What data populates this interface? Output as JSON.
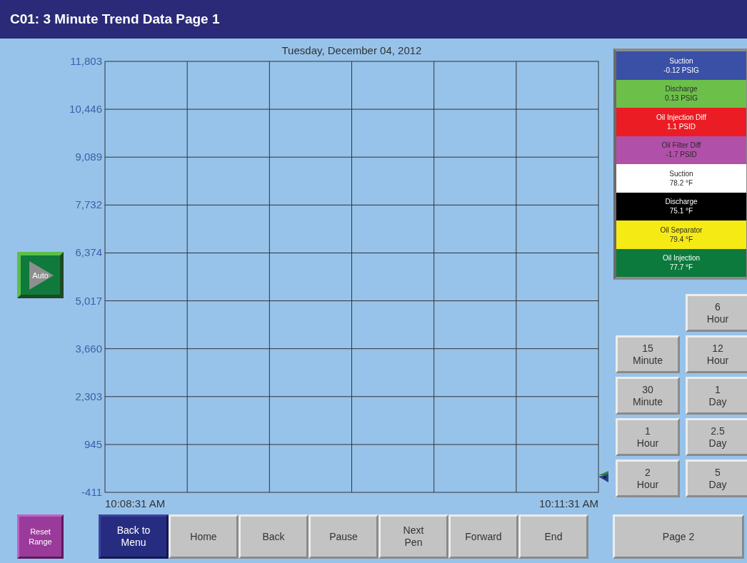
{
  "window": {
    "title": "C01: 3 Minute Trend Data Page 1"
  },
  "auto_button": {
    "label": "Auto"
  },
  "chart": {
    "chart_data": {
      "type": "line",
      "title": "Tuesday, December 04, 2012",
      "ylim": [
        -411,
        11803
      ],
      "yticks": [
        {
          "value": 11803,
          "label": "11,803"
        },
        {
          "value": 10446,
          "label": "10,446"
        },
        {
          "value": 9089,
          "label": "9,089"
        },
        {
          "value": 7732,
          "label": "7,732"
        },
        {
          "value": 6374,
          "label": "6,374"
        },
        {
          "value": 5017,
          "label": "5,017"
        },
        {
          "value": 3660,
          "label": "3,660"
        },
        {
          "value": 2303,
          "label": "2,303"
        },
        {
          "value": 945,
          "label": "945"
        },
        {
          "value": -411,
          "label": "-411"
        }
      ],
      "grid": true,
      "categories": [
        "10:08:31 AM",
        null,
        null,
        null,
        null,
        null,
        "10:11:31 AM"
      ]
    }
  },
  "legend": [
    {
      "name": "Suction",
      "reading": "-0.12 PSIG",
      "color": "#3a4fa6"
    },
    {
      "name": "Discharge",
      "reading": "0.13 PSIG",
      "color": "#6cc04a"
    },
    {
      "name": "Oil Injection Diff",
      "reading": "1.1 PSID",
      "color": "#ec1c24"
    },
    {
      "name": "Oil Filter Diff",
      "reading": "-1.7 PSID",
      "color": "#b150a8"
    },
    {
      "name": "Suction",
      "reading": "78.2 °F",
      "color": "#ffffff"
    },
    {
      "name": "Discharge",
      "reading": "75.1 °F",
      "color": "#000000"
    },
    {
      "name": "Oil Separator",
      "reading": "79.4 °F",
      "color": "#f5ea14"
    },
    {
      "name": "Oil Injection",
      "reading": "77.7 °F",
      "color": "#0b7a3c"
    }
  ],
  "range_buttons": {
    "column_1": [
      "15\nMinute",
      "30\nMinute",
      "1\nHour",
      "2\nHour"
    ],
    "column_2": [
      "6\nHour",
      "12\nHour",
      "1\nDay",
      "2.5\nDay",
      "5\nDay"
    ]
  },
  "bottom_buttons": [
    {
      "label": "Reset\nRange",
      "kind": "reset"
    },
    {
      "label": "Back to\nMenu",
      "kind": "menu"
    },
    {
      "label": "Home",
      "kind": "nav"
    },
    {
      "label": "Back",
      "kind": "nav"
    },
    {
      "label": "Pause",
      "kind": "nav"
    },
    {
      "label": "Next\nPen",
      "kind": "nav"
    },
    {
      "label": "Forward",
      "kind": "nav"
    },
    {
      "label": "End",
      "kind": "nav"
    },
    {
      "label": "Page 2",
      "kind": "page"
    }
  ]
}
